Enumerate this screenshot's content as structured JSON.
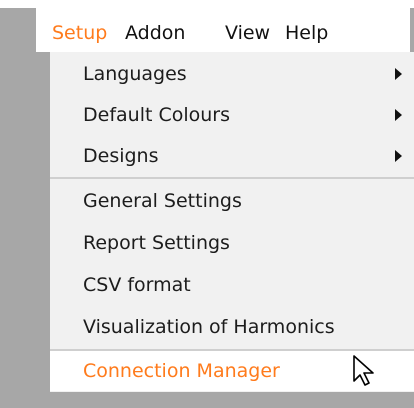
{
  "menubar": {
    "items": [
      {
        "label": "Setup",
        "active": true
      },
      {
        "label": "Addon"
      },
      {
        "label": "View"
      },
      {
        "label": "Help"
      }
    ]
  },
  "setup_menu": {
    "items": [
      {
        "label": "Languages",
        "submenu": true
      },
      {
        "label": "Default Colours",
        "submenu": true
      },
      {
        "label": "Designs",
        "submenu": true
      },
      {
        "label": "General Settings"
      },
      {
        "label": "Report Settings"
      },
      {
        "label": "CSV format"
      },
      {
        "label": "Visualization of Harmonics"
      },
      {
        "label": "Connection Manager",
        "highlighted": true
      }
    ]
  },
  "colors": {
    "accent": "#ff7b1c",
    "menu_background": "#f1f1f1",
    "desktop_background": "#a7a7a7"
  },
  "icons": {
    "submenu": "chevron-right-icon",
    "cursor": "mouse-pointer-icon"
  }
}
